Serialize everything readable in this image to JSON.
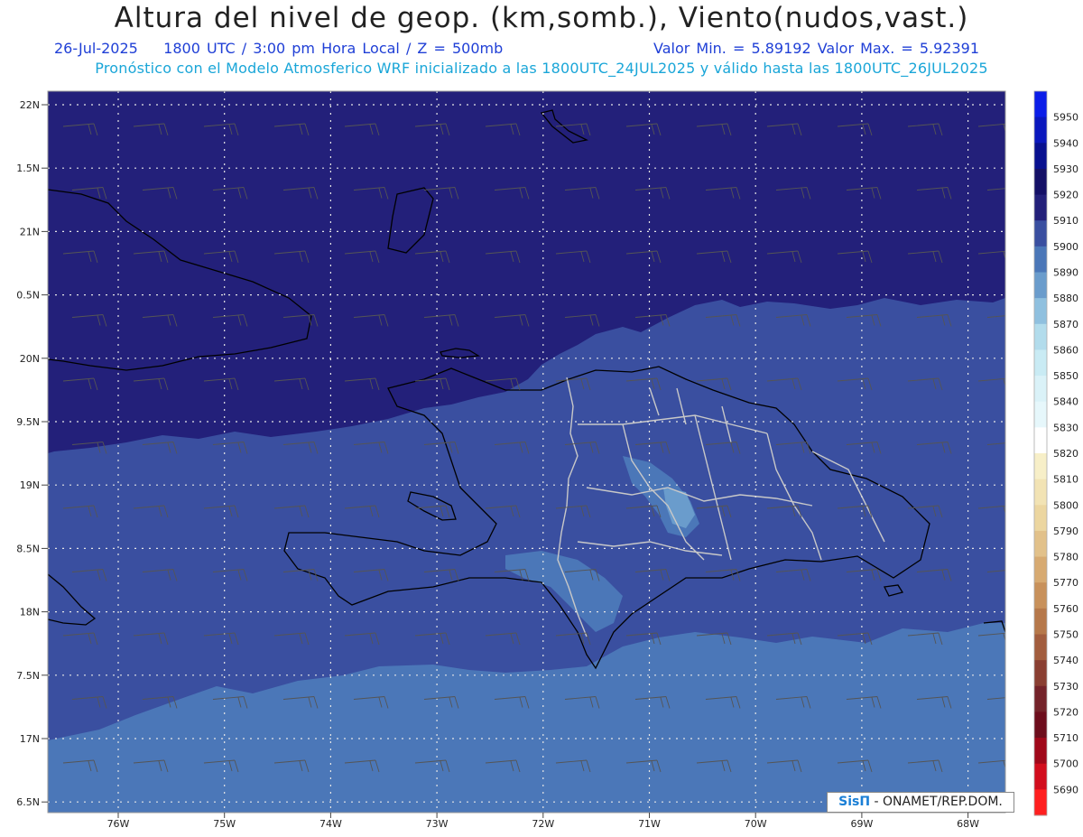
{
  "header": {
    "title": "Altura del nivel de geop. (km,somb.), Viento(nudos,vast.)",
    "date": "26-Jul-2025",
    "time_info": "1800 UTC / 3:00 pm Hora Local / Z = 500mb",
    "value_range": "Valor Min. = 5.89192  Valor Max. = 5.92391",
    "forecast_info": "Pronóstico con el Modelo Atmosferico WRF inicializado a las 1800UTC_24JUL2025 y válido hasta las  1800UTC_26JUL2025"
  },
  "axes": {
    "lat_labels": [
      "22N",
      "1.5N",
      "21N",
      "0.5N",
      "20N",
      "9.5N",
      "19N",
      "8.5N",
      "18N",
      "7.5N",
      "17N",
      "6.5N"
    ],
    "lon_labels": [
      "76W",
      "75W",
      "74W",
      "73W",
      "72W",
      "71W",
      "70W",
      "69W",
      "68W"
    ]
  },
  "colorbar": {
    "labels": [
      "5950",
      "5940",
      "5930",
      "5920",
      "5910",
      "5900",
      "5890",
      "5880",
      "5870",
      "5860",
      "5850",
      "5840",
      "5830",
      "5820",
      "5810",
      "5800",
      "5790",
      "5780",
      "5770",
      "5760",
      "5750",
      "5740",
      "5730",
      "5720",
      "5710",
      "5700",
      "5690"
    ],
    "colors": [
      "#0b1de8",
      "#0a17bd",
      "#08108f",
      "#141066",
      "#23207a",
      "#3a4fa0",
      "#4b77b8",
      "#6a9ccc",
      "#8fc0df",
      "#b2dcec",
      "#c9ebf4",
      "#daf2f8",
      "#e6f7fb",
      "#ffffff",
      "#f7efc8",
      "#f2e3b4",
      "#ecd6a0",
      "#e2c18a",
      "#d7aa71",
      "#c8915b",
      "#b6784a",
      "#a25d3e",
      "#8a3f32",
      "#74232a",
      "#6d0d1c",
      "#a0081a",
      "#d20d1d",
      "#ff1f1f"
    ]
  },
  "fill_colors": {
    "north_band": "#23207a",
    "middle_band": "#3a4fa0",
    "south_band": "#4b77b8",
    "island_patch": "#6a9ccc"
  },
  "credit": {
    "logo": "SisΠ",
    "text": "- ONAMET/REP.DOM."
  }
}
